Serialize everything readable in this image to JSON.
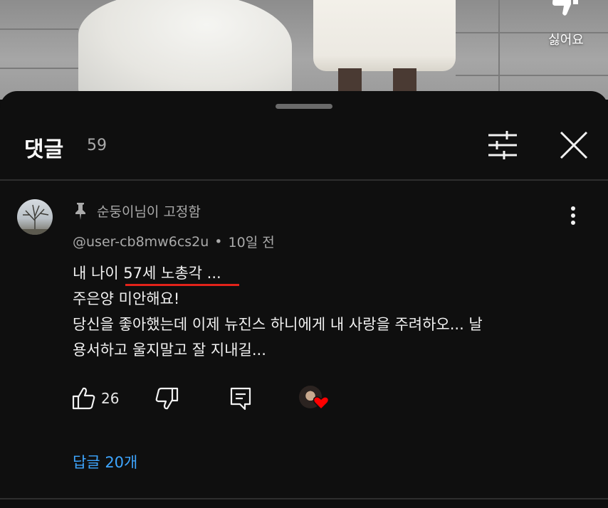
{
  "video": {
    "dislike_label": "싫어요"
  },
  "header": {
    "title": "댓글",
    "count": "59"
  },
  "comment": {
    "pinned_label": "순둥이님이 고정함",
    "author": "@user-cb8mw6cs2u",
    "separator": "•",
    "time": "10일 전",
    "lines": [
      "내 나이 57세 노총각 ...",
      "주은양 미안해요!",
      "당신을 좋아했는데 이제 뉴진스 하니에게 내 사랑을 주려하오... 날",
      "용서하고 울지말고 잘 지내길..."
    ],
    "like_count": "26",
    "replies_label": "답글 20개"
  },
  "colors": {
    "background": "#0f0f0f",
    "link": "#3ea6ff",
    "underline": "#e2231a",
    "heart": "#ff0000"
  }
}
